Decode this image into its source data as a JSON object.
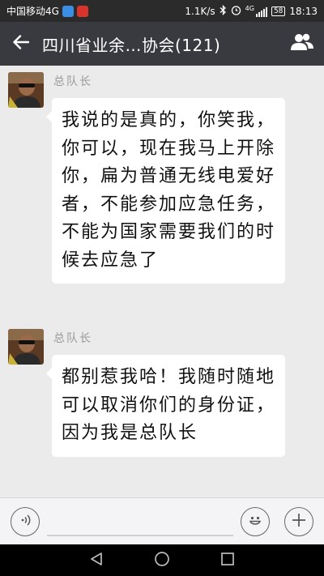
{
  "status_bar": {
    "carrier": "中国移动4G",
    "speed": "1.1K/s",
    "network": "4G",
    "battery": "58",
    "time": "18:13",
    "icons": [
      "app-notification-icon",
      "news-app-icon",
      "bluetooth-icon",
      "alarm-icon",
      "signal-icon",
      "battery-icon"
    ]
  },
  "header": {
    "title": "四川省业余…协会(121)",
    "back_icon": "arrow-left-icon",
    "members_icon": "group-members-icon"
  },
  "messages": [
    {
      "sender": "总队长",
      "text": "我说的是真的，你笑我，你可以，现在我马上开除你，扁为普通无线电爱好者，不能参加应急任务，不能为国家需要我们的时候去应急了"
    },
    {
      "sender": "总队长",
      "text": "都别惹我哈！我随时随地可以取消你们的身份证，因为我是总队长"
    }
  ],
  "input_bar": {
    "voice_icon": "voice-icon",
    "emoji_icon": "emoji-icon",
    "more_icon": "plus-icon"
  },
  "nav_bar": {
    "icons": [
      "back-triangle-icon",
      "home-circle-icon",
      "recents-square-icon"
    ]
  },
  "colors": {
    "title_bar": "#393a3f",
    "status_bar": "#2b2b2b",
    "chat_background": "#ebebeb",
    "bubble": "#ffffff"
  }
}
